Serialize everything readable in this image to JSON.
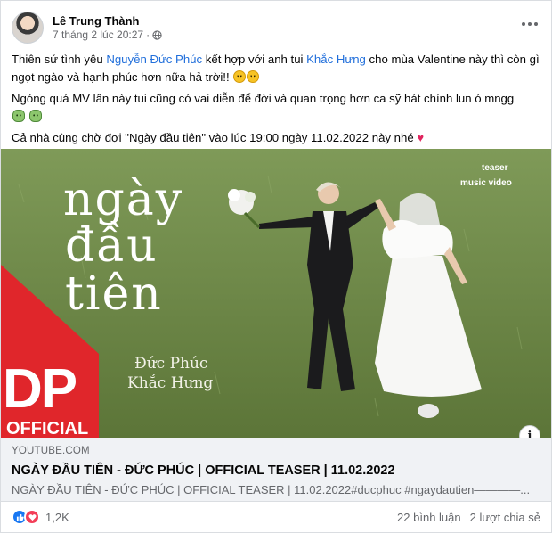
{
  "post": {
    "author": "Lê Trung Thành",
    "timestamp": "7 tháng 2 lúc 20:27",
    "dot": "·",
    "text": {
      "p1_a": "Thiên sứ tình yêu ",
      "mention1": "Nguyễn Đức Phúc",
      "p1_b": " kết hợp với anh tui ",
      "mention2": "Khắc Hưng",
      "p1_c": " cho mùa Valentine này thì còn gì ngọt ngào và hạnh phúc hơn nữa hả trời!!",
      "p2": "Ngóng quá MV lần này tui cũng có vai diễn để đời và quan trọng hơn ca sỹ hát chính lun ó mngg",
      "p3": "Cả nhà cùng chờ đợi \"Ngày đầu tiên\" vào lúc 19:00 ngày 11.02.2022 này nhé"
    },
    "icons": {
      "more": "more-horizontal-icon",
      "privacy": "globe-icon",
      "cry_emoji": "loudly-crying-face",
      "zombie_emoji": "zombie-face",
      "heart_emoji": "heart",
      "info": "info-icon",
      "like": "like-reaction",
      "love": "love-reaction"
    }
  },
  "thumbnail": {
    "title_line1": "ngày",
    "title_line2": "đầu",
    "title_line3": "tiên",
    "credits_line1": "Đức Phúc",
    "credits_line2": "Khắc Hưng",
    "badge_line1": "teaser",
    "badge_line2": "music video",
    "logo_text": "DP",
    "logo_sub": "OFFICIAL",
    "colors": {
      "grass": "#6f8a4a",
      "logo_red": "#e0262b"
    }
  },
  "link": {
    "domain": "YOUTUBE.COM",
    "title": "NGÀY ĐẦU TIÊN - ĐỨC PHÚC | OFFICIAL TEASER | 11.02.2022",
    "description": "NGÀY ĐẦU TIÊN - ĐỨC PHÚC | OFFICIAL TEASER | 11.02.2022#ducphuc #ngaydautien————..."
  },
  "footer": {
    "reaction_count": "1,2K",
    "comments": "22 bình luận",
    "shares": "2 lượt chia sẻ"
  }
}
